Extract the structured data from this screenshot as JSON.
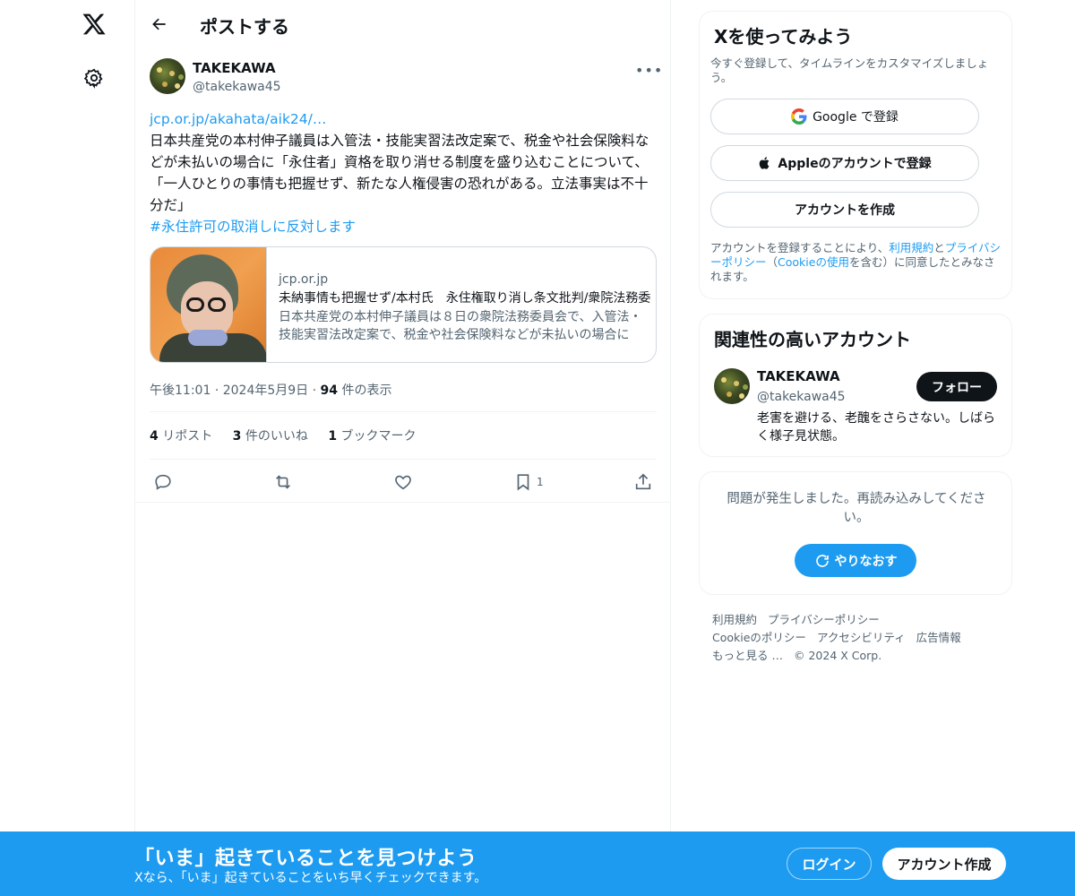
{
  "nav": {
    "logo_icon": "x-logo-icon",
    "settings_icon": "gear-icon"
  },
  "header": {
    "title": "ポストする",
    "back_icon": "arrow-left-icon"
  },
  "post": {
    "author_name": "TAKEKAWA",
    "author_handle": "@takekawa45",
    "link_text": "jcp.or.jp/akahata/aik24/…",
    "text": "日本共産党の本村伸子議員は入管法・技能実習法改定案で、税金や社会保険料などが未払いの場合に「永住者」資格を取り消せる制度を盛り込むことについて、「一人ひとりの事情も把握せず、新たな人権侵害の恐れがある。立法事実は不十分だ」",
    "hashtag": "#永住許可の取消しに反対します",
    "card": {
      "domain": "jcp.or.jp",
      "title": "未納事情も把握せず/本村氏　永住権取り消し条文批判/衆院法務委",
      "description": "日本共産党の本村伸子議員は８日の衆院法務委員会で、入管法・技能実習法改定案で、税金や社会保険料などが未払いの場合に"
    },
    "time": "午後11:01",
    "date": "2024年5月9日",
    "view_count": "94",
    "view_label": "件の表示",
    "separator": "·",
    "stats": {
      "reposts_count": "4",
      "reposts_label": "リポスト",
      "likes_count": "3",
      "likes_label": "件のいいね",
      "bookmarks_count": "1",
      "bookmarks_label": "ブックマーク"
    },
    "actions": {
      "reply_icon": "reply-icon",
      "repost_icon": "repost-icon",
      "like_icon": "heart-icon",
      "bookmark_icon": "bookmark-icon",
      "bookmark_count": "1",
      "share_icon": "share-icon"
    }
  },
  "signup_box": {
    "title": "Xを使ってみよう",
    "subtitle": "今すぐ登録して、タイムラインをカスタマイズしましょう。",
    "google_label": "Google で登録",
    "apple_label": "Appleのアカウントで登録",
    "create_label": "アカウントを作成",
    "legal_prefix": "アカウントを登録することにより、",
    "legal_terms": "利用規約",
    "legal_and": "と",
    "legal_privacy": "プライバシーポリシー",
    "legal_paren_open": "（",
    "legal_cookie": "Cookieの使用",
    "legal_suffix": "を含む）に同意したとみなされます。"
  },
  "relevant_box": {
    "title": "関連性の高いアカウント",
    "name": "TAKEKAWA",
    "handle": "@takekawa45",
    "bio": "老害を避ける、老醜をさらさない。しばらく様子見状態。",
    "follow_label": "フォロー"
  },
  "error_box": {
    "message": "問題が発生しました。再読み込みしてください。",
    "retry_label": "やりなおす"
  },
  "footer": {
    "links": [
      "利用規約",
      "プライバシーポリシー",
      "Cookieのポリシー",
      "アクセシビリティ",
      "広告情報",
      "もっと見る …"
    ],
    "copyright": "© 2024 X Corp."
  },
  "banner": {
    "title": "「いま」起きていることを見つけよう",
    "subtitle": "Xなら、「いま」起きていることをいち早くチェックできます。",
    "login_label": "ログイン",
    "signup_label": "アカウント作成"
  },
  "colors": {
    "accent": "#1d9bf0",
    "text": "#0f1419",
    "muted": "#536471",
    "border": "#eff3f4"
  }
}
